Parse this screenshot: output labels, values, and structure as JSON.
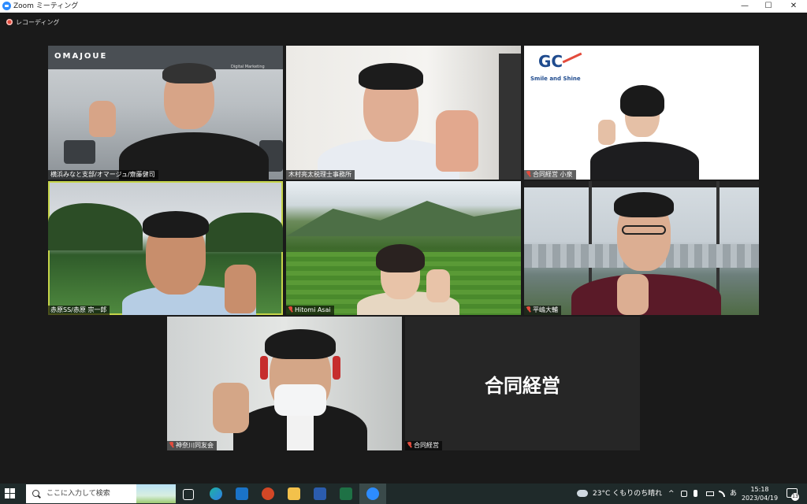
{
  "window": {
    "title": "Zoom ミーティング",
    "minimize_glyph": "—",
    "maximize_glyph": "☐",
    "close_glyph": "✕"
  },
  "recording": {
    "label": "レコーディング"
  },
  "participants": [
    {
      "name": "横浜みなと支部/オマージュ/齋藤健司",
      "muted": false,
      "logo": "OMAJOUE",
      "logo_sub": "Digital Marketing"
    },
    {
      "name": "木村亮太税理士事務所",
      "muted": false
    },
    {
      "name": "合同経営 小泉",
      "muted": true,
      "logo": "GC",
      "logo_sub": "Smile and Shine"
    },
    {
      "name": "赤原SS/赤原 宗一郎",
      "muted": false,
      "active_speaker": true
    },
    {
      "name": "Hitomi Asai",
      "muted": true
    },
    {
      "name": "平嶋大輔",
      "muted": true
    },
    {
      "name": "神奈川同友会",
      "muted": true
    },
    {
      "name": "合同経営",
      "muted": true,
      "video_off_text": "合同経営"
    }
  ],
  "taskbar": {
    "search_placeholder": "ここに入力して検索",
    "weather": "23°C くもりのち晴れ",
    "ime": "あ",
    "time": "15:18",
    "date": "2023/04/19",
    "notification_count": "13"
  },
  "colors": {
    "active_speaker_border": "#c6d54a",
    "muted_mic": "#e34b3c",
    "zoom_blue": "#2d8cff"
  }
}
